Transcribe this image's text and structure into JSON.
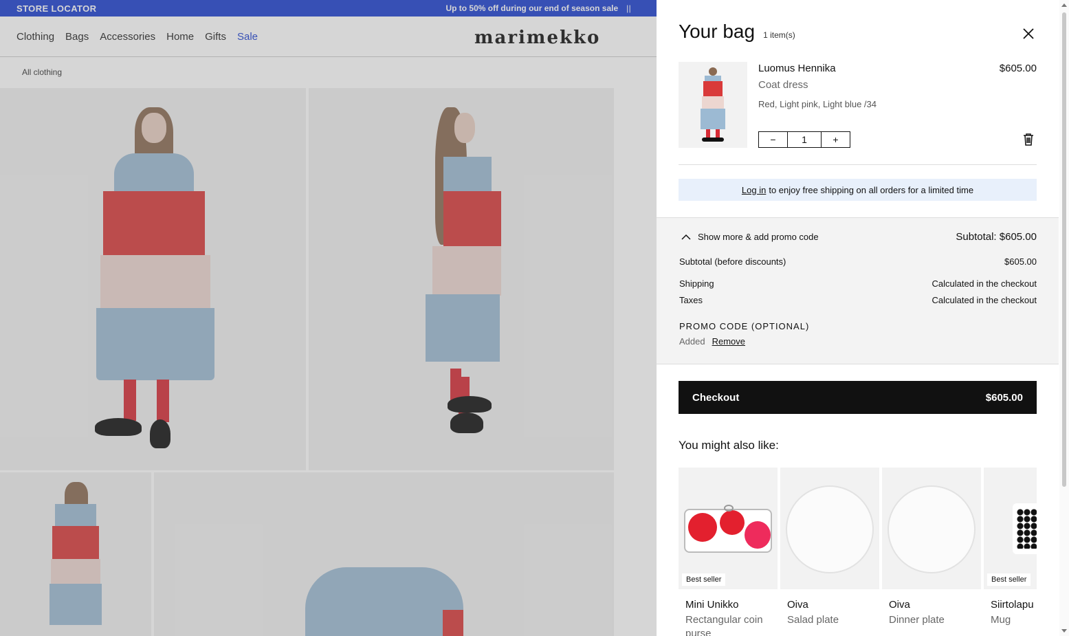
{
  "topbar": {
    "store_locator": "STORE LOCATOR",
    "promo": "Up to 50% off during our end of season sale",
    "pause": "||"
  },
  "nav": {
    "items": [
      "Clothing",
      "Bags",
      "Accessories",
      "Home",
      "Gifts",
      "Sale"
    ],
    "logo": "marimekko"
  },
  "breadcrumb": "All clothing",
  "bag": {
    "title": "Your bag",
    "count": "1 item(s)",
    "item": {
      "name": "Luomus Hennika",
      "subtitle": "Coat dress",
      "variant": "Red, Light pink, Light blue /34",
      "price": "$605.00",
      "quantity": "1",
      "minus": "−",
      "plus": "+"
    },
    "notice": {
      "link": "Log in",
      "text": "to enjoy free shipping on all orders for a limited time"
    },
    "summary": {
      "toggle": "Show more & add promo code",
      "subtotal_header": "Subtotal: $605.00",
      "rows": [
        {
          "label": "Subtotal (before discounts)",
          "value": "$605.00"
        },
        {
          "label": "Shipping",
          "value": "Calculated in the checkout"
        },
        {
          "label": "Taxes",
          "value": "Calculated in the checkout"
        }
      ],
      "promo_label": "PROMO CODE (OPTIONAL)",
      "promo_status": "Added",
      "promo_remove": "Remove"
    },
    "checkout": {
      "label": "Checkout",
      "price": "$605.00"
    },
    "also_like": "You might also like:",
    "recommendations": [
      {
        "name": "Mini Unikko",
        "sub": "Rectangular coin purse",
        "badge": "Best seller"
      },
      {
        "name": "Oiva",
        "sub": "Salad plate",
        "badge": ""
      },
      {
        "name": "Oiva",
        "sub": "Dinner plate",
        "badge": ""
      },
      {
        "name": "Siirtolapu",
        "sub": "Mug",
        "badge": "Best seller"
      }
    ]
  },
  "colors": {
    "brand_blue": "#1c3fd0",
    "checkout_bg": "#111111",
    "notice_bg": "#e8f0fb",
    "dress_red": "#d93a3a",
    "dress_pink": "#ecd6d0",
    "dress_blue": "#9cbad3"
  }
}
